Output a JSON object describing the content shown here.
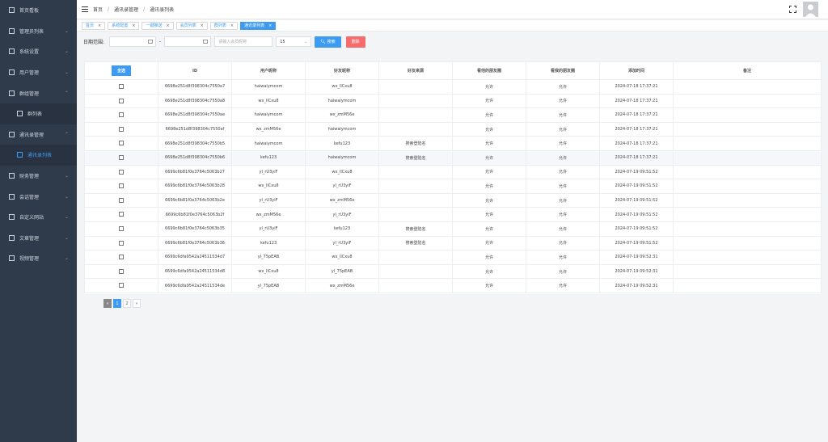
{
  "sidebar": {
    "items": [
      {
        "label": "首页看板",
        "icon": "dashboard-icon",
        "chevron": ""
      },
      {
        "label": "管理员列表",
        "icon": "user-icon",
        "chevron": "⌄"
      },
      {
        "label": "系统设置",
        "icon": "gear-icon",
        "chevron": "⌄"
      },
      {
        "label": "用户管理",
        "icon": "user-icon",
        "chevron": "⌄"
      },
      {
        "label": "群组管理",
        "icon": "users-icon",
        "chevron": "⌃"
      },
      {
        "label": "群列表",
        "icon": "grid-icon",
        "chevron": "",
        "sub": true
      },
      {
        "label": "通讯录管理",
        "icon": "user-icon",
        "chevron": "⌃"
      },
      {
        "label": "通讯录列表",
        "icon": "grid-icon",
        "chevron": "",
        "sub": true,
        "active": true
      },
      {
        "label": "财务管理",
        "icon": "chart-icon",
        "chevron": "⌄"
      },
      {
        "label": "会话管理",
        "icon": "chat-icon",
        "chevron": "⌄"
      },
      {
        "label": "自定义网站",
        "icon": "web-icon",
        "chevron": "⌄"
      },
      {
        "label": "文章管理",
        "icon": "doc-icon",
        "chevron": "⌄"
      },
      {
        "label": "视频管理",
        "icon": "video-icon",
        "chevron": "⌄"
      }
    ]
  },
  "breadcrumb": [
    "首页",
    "通讯录管理",
    "通讯录列表"
  ],
  "breadcrumb_sep": "/",
  "tabs": [
    {
      "label": "首页",
      "active": false
    },
    {
      "label": "系统配置",
      "active": false
    },
    {
      "label": "一键推送",
      "active": false
    },
    {
      "label": "会员列表",
      "active": false
    },
    {
      "label": "群列表",
      "active": false
    },
    {
      "label": "通讯录列表",
      "active": true
    }
  ],
  "tab_close": "×",
  "filter": {
    "label": "日期范围:",
    "dash": "-",
    "keyword_placeholder": "请输入会员昵称",
    "page_size": "15",
    "search_label": "搜索",
    "delete_label": "删除"
  },
  "table": {
    "select_all": "全选",
    "columns": [
      "ID",
      "用户昵称",
      "好友昵称",
      "好友来源",
      "看他的朋友圈",
      "看我的朋友圈",
      "添加时间",
      "备注"
    ],
    "rows": [
      {
        "id": "6698e251d8f398304c7550a7",
        "user": "haiwaiymcom",
        "friend": "wx_llCxu8",
        "source": "",
        "see_his": "允许",
        "see_mine": "允许",
        "time": "2024-07-18 17:37:21",
        "note": ""
      },
      {
        "id": "6698e251d8f398304c7550a8",
        "user": "wx_llCxu8",
        "friend": "haiwaiymcom",
        "source": "",
        "see_his": "允许",
        "see_mine": "允许",
        "time": "2024-07-18 17:37:21",
        "note": ""
      },
      {
        "id": "6698e251d8f398304c7550ae",
        "user": "haiwaiymcom",
        "friend": "wx_zmM56e",
        "source": "",
        "see_his": "允许",
        "see_mine": "允许",
        "time": "2024-07-18 17:37:21",
        "note": ""
      },
      {
        "id": "6698e251d8f398304c7550af",
        "user": "wx_zmM56e",
        "friend": "haiwaiymcom",
        "source": "",
        "see_his": "允许",
        "see_mine": "允许",
        "time": "2024-07-18 17:37:21",
        "note": ""
      },
      {
        "id": "6698e251d8f398304c7550b5",
        "user": "haiwaiymcom",
        "friend": "kefu123",
        "source": "搜索登陆名",
        "see_his": "允许",
        "see_mine": "允许",
        "time": "2024-07-18 17:37:21",
        "note": ""
      },
      {
        "id": "6698e251d8f398304c7550b6",
        "user": "kefu123",
        "friend": "haiwaiymcom",
        "source": "搜索登陆名",
        "see_his": "允许",
        "see_mine": "允许",
        "time": "2024-07-18 17:37:21",
        "note": "",
        "highlight": true
      },
      {
        "id": "6699c6b81f0e3764c5063b27",
        "user": "yl_rU3yiF",
        "friend": "wx_llCxu8",
        "source": "",
        "see_his": "允许",
        "see_mine": "允许",
        "time": "2024-07-19 09:51:52",
        "note": ""
      },
      {
        "id": "6699c6b81f0e3764c5063b28",
        "user": "wx_llCxu8",
        "friend": "yl_rU3yiF",
        "source": "",
        "see_his": "允许",
        "see_mine": "允许",
        "time": "2024-07-19 09:51:52",
        "note": ""
      },
      {
        "id": "6699c6b81f0e3764c5063b2e",
        "user": "yl_rU3yiF",
        "friend": "wx_zmM56e",
        "source": "",
        "see_his": "允许",
        "see_mine": "允许",
        "time": "2024-07-19 09:51:52",
        "note": ""
      },
      {
        "id": "6699c6b81f0e3764c5063b2f",
        "user": "wx_zmM56e",
        "friend": "yl_rU3yiF",
        "source": "",
        "see_his": "允许",
        "see_mine": "允许",
        "time": "2024-07-19 09:51:52",
        "note": ""
      },
      {
        "id": "6699c6b81f0e3764c5063b35",
        "user": "yl_rU3yiF",
        "friend": "kefu123",
        "source": "搜索登陆名",
        "see_his": "允许",
        "see_mine": "允许",
        "time": "2024-07-19 09:51:52",
        "note": ""
      },
      {
        "id": "6699c6b81f0e3764c5063b36",
        "user": "kefu123",
        "friend": "yl_rU3yiF",
        "source": "搜索登陆名",
        "see_his": "允许",
        "see_mine": "允许",
        "time": "2024-07-19 09:51:52",
        "note": ""
      },
      {
        "id": "6699c6dfa9542a24511534d7",
        "user": "yl_75pEAB",
        "friend": "wx_llCxu8",
        "source": "",
        "see_his": "允许",
        "see_mine": "允许",
        "time": "2024-07-19 09:52:31",
        "note": ""
      },
      {
        "id": "6699c6dfa9542a24511534d8",
        "user": "wx_llCxu8",
        "friend": "yl_75pEAB",
        "source": "",
        "see_his": "允许",
        "see_mine": "允许",
        "time": "2024-07-19 09:52:31",
        "note": ""
      },
      {
        "id": "6699c6dfa9542a24511534de",
        "user": "yl_75pEAB",
        "friend": "wx_zmM56e",
        "source": "",
        "see_his": "允许",
        "see_mine": "允许",
        "time": "2024-07-19 09:52:31",
        "note": ""
      }
    ]
  },
  "pagination": {
    "prev": "«",
    "pages": [
      "1",
      "2"
    ],
    "current": "1",
    "next": "»"
  },
  "colors": {
    "accent": "#3d9cf1",
    "danger": "#f56c6c",
    "sidebar": "#2f3a4a"
  }
}
